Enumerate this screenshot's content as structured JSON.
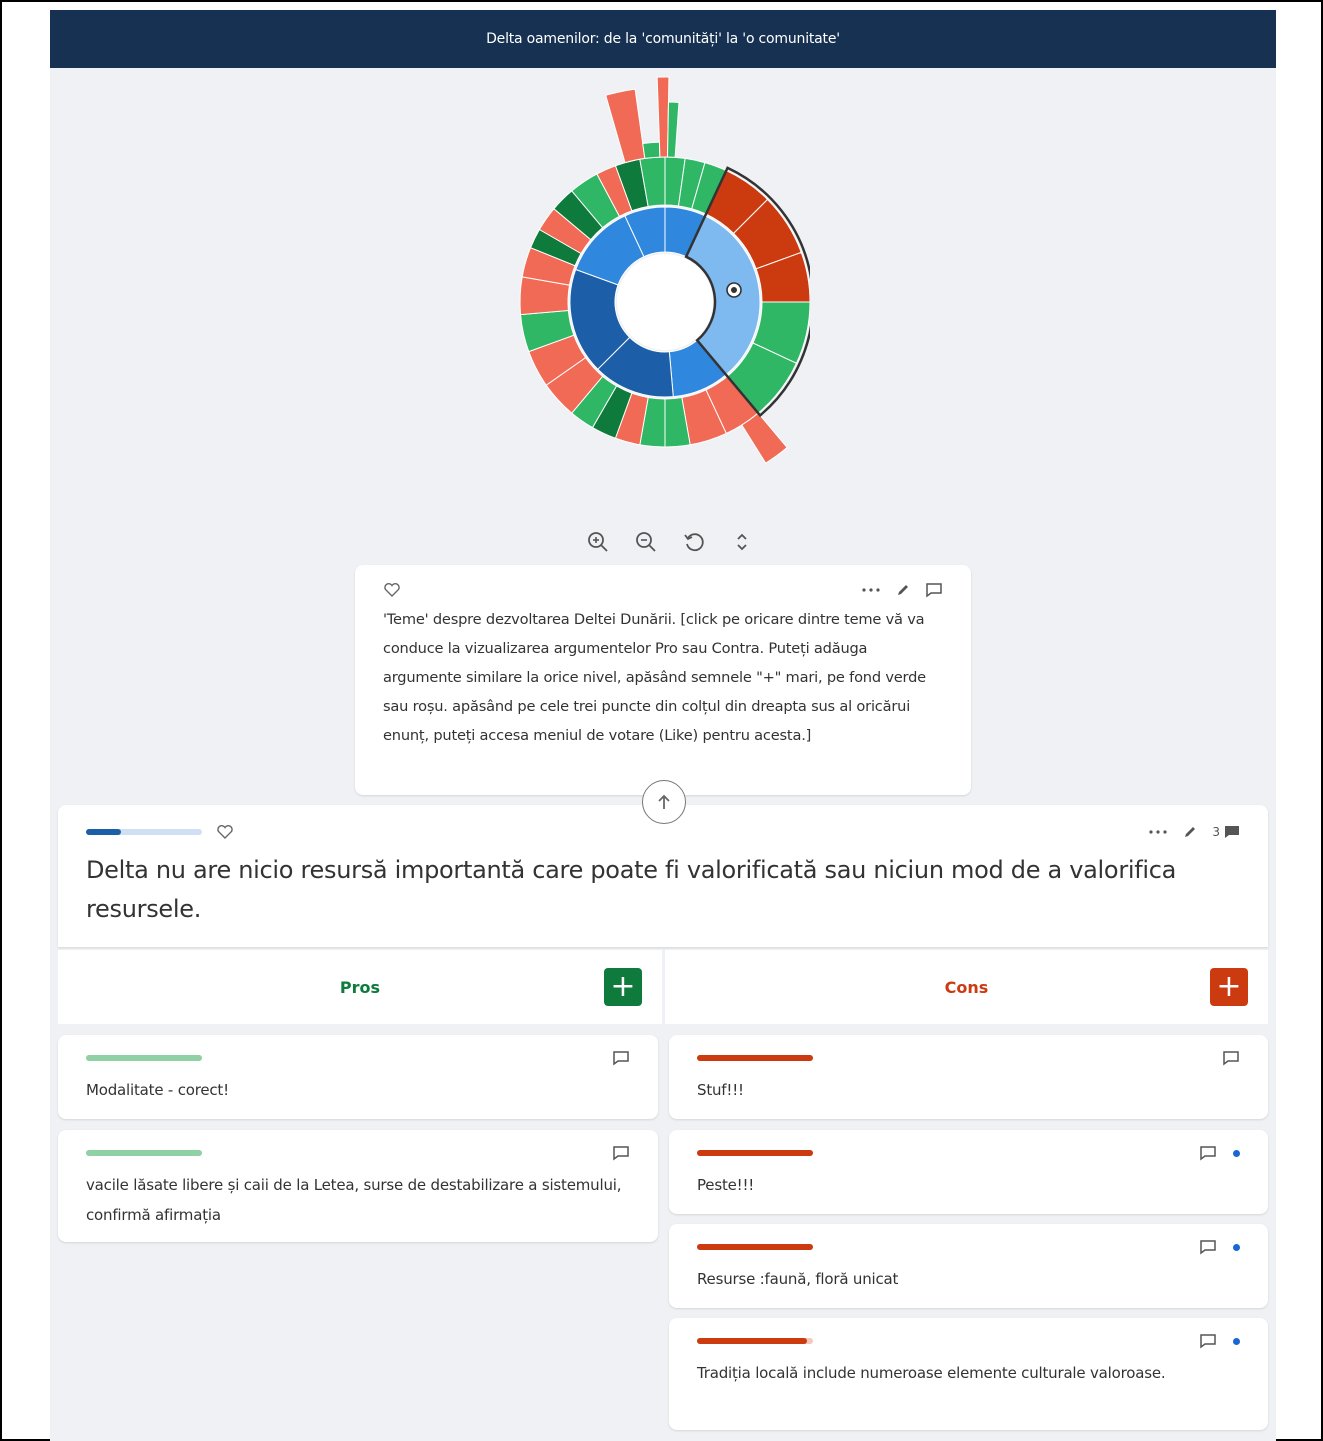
{
  "header": {
    "title": "Delta oamenilor: de la 'comunități' la 'o comunitate'"
  },
  "colors": {
    "navy": "#173152",
    "pro": "#0e7a3b",
    "con": "#cc3a10",
    "blue_dark": "#1c5fa8",
    "blue_mid": "#2f87de",
    "blue_light": "#7eb9f0"
  },
  "sunburst": {
    "icons": [
      "zoom-in-icon",
      "zoom-out-icon",
      "reset-icon",
      "expand-icon"
    ]
  },
  "topic": {
    "text": "'Teme' despre dezvoltarea Deltei Dunării. [click pe oricare dintre teme vă va conduce la vizualizarea argumentelor Pro sau Contra. Puteți adăuga argumente similare la orice nivel, apăsând semnele \"+\" mari, pe fond verde sau roșu. apăsând pe cele trei puncte din colțul din dreapta sus al oricărui enunț, puteți accesa meniul de votare (Like) pentru acesta.]"
  },
  "claim": {
    "title": "Delta nu are nicio resursă importantă care poate fi valorificată sau niciun mod de a valorifica resursele.",
    "comment_count": "3",
    "vote_fraction": 0.3
  },
  "columns": {
    "pros_label": "Pros",
    "cons_label": "Cons",
    "plus": "+"
  },
  "pros": [
    {
      "text": "Modalitate - corect!",
      "vote_fraction": 1.0
    },
    {
      "text": "vacile lăsate libere și caii de la Letea, surse de destabilizare a sistemului, confirmă afirmația",
      "vote_fraction": 1.0
    }
  ],
  "cons": [
    {
      "text": "Stuf!!!",
      "vote_fraction": 1.0,
      "new": false
    },
    {
      "text": "Peste!!!",
      "vote_fraction": 1.0,
      "new": true
    },
    {
      "text": "Resurse :faună, floră unicat",
      "vote_fraction": 1.0,
      "new": true
    },
    {
      "text": "Tradiția locală include numeroase elemente culturale valoroase.",
      "vote_fraction": 0.95,
      "new": true
    }
  ]
}
